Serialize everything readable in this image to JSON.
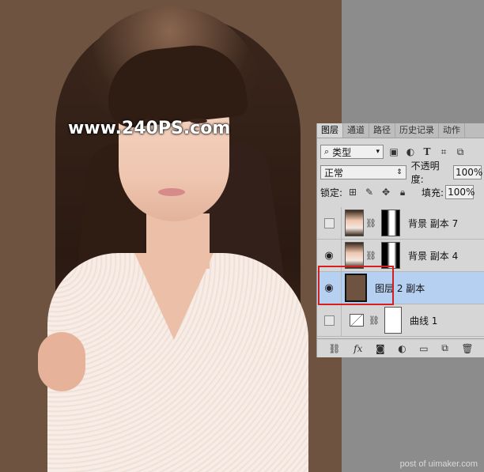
{
  "canvas": {
    "background_color": "#6e5340",
    "watermark": "www.240PS.com",
    "credit": "post of uimaker.com"
  },
  "panel": {
    "tabs": [
      "图层",
      "通道",
      "路径",
      "历史记录",
      "动作"
    ],
    "active_tab": "图层",
    "filter": {
      "kind_label": "类型",
      "icons": [
        "image-filter-icon",
        "adjustment-filter-icon",
        "type-filter-icon",
        "shape-filter-icon",
        "smart-object-filter-icon"
      ]
    },
    "blend": {
      "mode": "正常",
      "opacity_label": "不透明度:",
      "opacity_value": "100%"
    },
    "lock": {
      "label": "锁定:",
      "fill_label": "填充:",
      "fill_value": "100%"
    },
    "layers": [
      {
        "name": "背景 副本 7",
        "visible": false,
        "type": "photo-with-mask"
      },
      {
        "name": "背景 副本 4",
        "visible": true,
        "type": "photo-with-mask"
      },
      {
        "name": "图层 2 副本",
        "visible": true,
        "type": "fill",
        "selected": true,
        "fill_color": "#6e5340"
      },
      {
        "name": "曲线 1",
        "visible": false,
        "type": "curves-adjustment"
      }
    ],
    "bottom_icons": [
      "link-icon",
      "fx-icon",
      "mask-icon",
      "adjustment-icon",
      "group-icon",
      "new-layer-icon",
      "delete-icon"
    ],
    "highlight_color": "#d42020"
  }
}
